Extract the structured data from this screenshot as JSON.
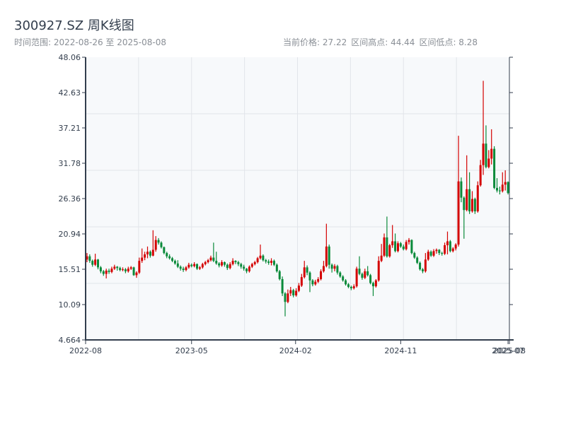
{
  "header": {
    "title": "300927.SZ 周K线图",
    "date_range": "时间范围: 2022-08-26 至 2025-08-08",
    "current_price": "当前价格: 27.22",
    "range_high": "区间高点: 44.44",
    "range_low": "区间低点: 8.28"
  },
  "chart_data": {
    "type": "candlestick",
    "title": "300927.SZ 周K线图",
    "ylim": [
      4.664,
      48.06
    ],
    "y_ticks": [
      "48.06",
      "42.63",
      "37.21",
      "31.78",
      "26.36",
      "20.94",
      "15.51",
      "10.09",
      "4.664"
    ],
    "x_ticks": [
      {
        "label": "2022-08",
        "index": 0
      },
      {
        "label": "2023-05",
        "index": 38.5
      },
      {
        "label": "2024-02",
        "index": 76.3
      },
      {
        "label": "2024-11",
        "index": 114.5
      },
      {
        "label": "2025-07",
        "index": 153.5
      },
      {
        "label": "2025-08",
        "index": 154.6
      }
    ],
    "grid": true,
    "colors": {
      "up": "#d40000",
      "down": "#0a8a3a",
      "axis": "#333e4d",
      "grid": "#e2e5ea",
      "plot_bg": "#f7f9fb"
    },
    "ohlc": [
      [
        17.0,
        18.0,
        16.6,
        17.5
      ],
      [
        17.5,
        17.8,
        16.5,
        16.8
      ],
      [
        16.8,
        17.0,
        15.9,
        16.2
      ],
      [
        16.2,
        17.9,
        16.0,
        17.0
      ],
      [
        17.0,
        17.1,
        15.5,
        15.8
      ],
      [
        15.8,
        16.0,
        14.9,
        15.2
      ],
      [
        15.2,
        15.4,
        14.5,
        14.8
      ],
      [
        14.8,
        15.6,
        14.1,
        15.3
      ],
      [
        15.3,
        15.6,
        14.8,
        15.1
      ],
      [
        15.1,
        15.9,
        14.9,
        15.6
      ],
      [
        15.6,
        16.2,
        15.4,
        15.9
      ],
      [
        15.9,
        16.0,
        15.3,
        15.7
      ],
      [
        15.7,
        15.9,
        15.2,
        15.4
      ],
      [
        15.4,
        15.8,
        15.2,
        15.5
      ],
      [
        15.5,
        15.7,
        14.9,
        15.2
      ],
      [
        15.2,
        15.9,
        15.0,
        15.6
      ],
      [
        15.6,
        16.0,
        15.4,
        15.8
      ],
      [
        15.8,
        15.9,
        14.5,
        14.6
      ],
      [
        14.6,
        15.2,
        14.2,
        15.0
      ],
      [
        15.0,
        17.3,
        14.8,
        16.8
      ],
      [
        16.8,
        18.7,
        16.5,
        17.3
      ],
      [
        17.3,
        18.2,
        16.9,
        17.8
      ],
      [
        17.8,
        19.0,
        17.2,
        18.2
      ],
      [
        18.2,
        18.4,
        17.3,
        17.6
      ],
      [
        17.6,
        21.5,
        17.5,
        18.5
      ],
      [
        18.5,
        20.6,
        18.2,
        20.0
      ],
      [
        20.0,
        20.3,
        19.3,
        19.6
      ],
      [
        19.6,
        19.8,
        18.7,
        18.9
      ],
      [
        18.9,
        19.0,
        17.8,
        18.0
      ],
      [
        18.0,
        18.2,
        17.2,
        17.5
      ],
      [
        17.5,
        17.8,
        17.0,
        17.2
      ],
      [
        17.2,
        17.4,
        16.6,
        16.8
      ],
      [
        16.8,
        17.0,
        16.2,
        16.4
      ],
      [
        16.4,
        16.9,
        15.7,
        15.9
      ],
      [
        15.9,
        16.1,
        15.3,
        15.6
      ],
      [
        15.6,
        15.9,
        15.1,
        15.4
      ],
      [
        15.4,
        16.0,
        15.2,
        15.8
      ],
      [
        15.8,
        16.5,
        15.6,
        16.2
      ],
      [
        16.2,
        16.4,
        15.8,
        16.0
      ],
      [
        16.0,
        16.6,
        15.8,
        16.3
      ],
      [
        16.3,
        16.4,
        15.4,
        15.6
      ],
      [
        15.6,
        16.0,
        15.4,
        15.8
      ],
      [
        15.8,
        16.5,
        15.6,
        16.3
      ],
      [
        16.3,
        16.8,
        16.1,
        16.6
      ],
      [
        16.6,
        17.1,
        16.4,
        16.9
      ],
      [
        16.9,
        17.6,
        16.7,
        17.3
      ],
      [
        17.3,
        19.6,
        16.6,
        16.8
      ],
      [
        16.8,
        18.2,
        16.2,
        16.4
      ],
      [
        16.4,
        16.6,
        15.8,
        16.1
      ],
      [
        16.1,
        16.9,
        15.9,
        16.6
      ],
      [
        16.6,
        16.7,
        15.9,
        16.2
      ],
      [
        16.2,
        16.4,
        15.4,
        15.7
      ],
      [
        15.7,
        16.6,
        15.5,
        16.3
      ],
      [
        16.3,
        17.2,
        16.1,
        16.8
      ],
      [
        16.8,
        16.9,
        16.3,
        16.6
      ],
      [
        16.6,
        16.8,
        16.0,
        16.3
      ],
      [
        16.3,
        16.5,
        15.6,
        15.9
      ],
      [
        15.9,
        16.2,
        15.3,
        15.6
      ],
      [
        15.6,
        15.7,
        14.9,
        15.2
      ],
      [
        15.2,
        16.1,
        15.0,
        15.9
      ],
      [
        15.9,
        16.5,
        15.7,
        16.3
      ],
      [
        16.3,
        16.8,
        16.1,
        16.6
      ],
      [
        16.6,
        17.4,
        16.4,
        17.2
      ],
      [
        17.2,
        19.3,
        17.0,
        17.6
      ],
      [
        17.6,
        17.8,
        16.7,
        16.9
      ],
      [
        16.9,
        17.1,
        16.4,
        16.7
      ],
      [
        16.7,
        17.0,
        16.2,
        16.5
      ],
      [
        16.5,
        17.2,
        16.1,
        16.8
      ],
      [
        16.8,
        17.0,
        16.0,
        16.2
      ],
      [
        16.2,
        16.4,
        15.0,
        15.2
      ],
      [
        15.2,
        15.4,
        13.8,
        14.0
      ],
      [
        14.0,
        14.4,
        11.4,
        11.8
      ],
      [
        11.8,
        12.0,
        8.28,
        10.5
      ],
      [
        10.5,
        12.4,
        10.3,
        11.8
      ],
      [
        11.8,
        12.8,
        11.4,
        12.3
      ],
      [
        12.3,
        12.5,
        11.2,
        11.5
      ],
      [
        11.5,
        12.6,
        11.3,
        12.2
      ],
      [
        12.2,
        13.4,
        12.0,
        13.0
      ],
      [
        13.0,
        14.8,
        12.8,
        14.3
      ],
      [
        14.3,
        16.8,
        14.1,
        15.8
      ],
      [
        15.8,
        16.1,
        14.6,
        15.0
      ],
      [
        15.0,
        15.2,
        12.0,
        13.8
      ],
      [
        13.8,
        14.0,
        12.9,
        13.2
      ],
      [
        13.2,
        13.9,
        13.0,
        13.6
      ],
      [
        13.6,
        14.3,
        13.4,
        14.0
      ],
      [
        14.0,
        15.5,
        13.8,
        15.2
      ],
      [
        15.2,
        16.8,
        15.0,
        16.0
      ],
      [
        16.0,
        22.5,
        15.8,
        19.0
      ],
      [
        19.0,
        19.3,
        15.6,
        16.2
      ],
      [
        16.2,
        16.4,
        15.0,
        15.6
      ],
      [
        15.6,
        16.3,
        15.2,
        16.0
      ],
      [
        16.0,
        16.2,
        14.7,
        15.0
      ],
      [
        15.0,
        15.2,
        14.2,
        14.4
      ],
      [
        14.4,
        14.6,
        13.6,
        13.8
      ],
      [
        13.8,
        14.0,
        13.0,
        13.2
      ],
      [
        13.2,
        13.4,
        12.6,
        12.8
      ],
      [
        12.8,
        13.0,
        12.3,
        12.6
      ],
      [
        12.6,
        13.2,
        12.4,
        12.9
      ],
      [
        12.9,
        15.9,
        12.7,
        15.6
      ],
      [
        15.6,
        17.5,
        14.6,
        14.8
      ],
      [
        14.8,
        15.0,
        13.9,
        14.2
      ],
      [
        14.2,
        15.6,
        14.0,
        15.2
      ],
      [
        15.2,
        16.0,
        14.4,
        14.6
      ],
      [
        14.6,
        14.8,
        13.2,
        13.4
      ],
      [
        13.4,
        13.6,
        11.4,
        12.9
      ],
      [
        12.9,
        14.0,
        12.7,
        13.8
      ],
      [
        13.8,
        17.5,
        13.6,
        16.8
      ],
      [
        16.8,
        19.4,
        16.6,
        17.6
      ],
      [
        17.6,
        21.0,
        17.4,
        20.4
      ],
      [
        20.4,
        23.6,
        17.3,
        17.5
      ],
      [
        17.5,
        19.4,
        17.3,
        19.2
      ],
      [
        19.2,
        22.3,
        18.8,
        19.8
      ],
      [
        19.8,
        21.0,
        18.1,
        18.3
      ],
      [
        18.3,
        19.8,
        18.1,
        19.5
      ],
      [
        19.5,
        19.7,
        18.8,
        19.0
      ],
      [
        19.0,
        19.3,
        18.4,
        18.6
      ],
      [
        18.6,
        20.0,
        18.4,
        19.7
      ],
      [
        19.7,
        20.3,
        19.3,
        20.0
      ],
      [
        20.0,
        20.1,
        17.8,
        18.0
      ],
      [
        18.0,
        18.2,
        17.1,
        17.3
      ],
      [
        17.3,
        17.5,
        16.3,
        16.5
      ],
      [
        16.5,
        16.7,
        15.3,
        15.5
      ],
      [
        15.5,
        15.7,
        14.9,
        15.2
      ],
      [
        15.2,
        18.0,
        15.0,
        17.0
      ],
      [
        17.0,
        18.5,
        16.8,
        18.2
      ],
      [
        18.2,
        18.4,
        17.4,
        17.6
      ],
      [
        17.6,
        18.6,
        17.4,
        18.3
      ],
      [
        18.3,
        18.7,
        17.9,
        18.5
      ],
      [
        18.5,
        18.6,
        17.7,
        18.0
      ],
      [
        18.0,
        18.2,
        17.6,
        17.9
      ],
      [
        17.9,
        19.6,
        17.7,
        19.2
      ],
      [
        19.2,
        21.3,
        17.8,
        19.8
      ],
      [
        19.8,
        20.0,
        18.1,
        18.3
      ],
      [
        18.3,
        18.9,
        18.1,
        18.7
      ],
      [
        18.7,
        19.5,
        18.4,
        19.3
      ],
      [
        19.3,
        36.0,
        19.0,
        29.0
      ],
      [
        29.0,
        29.6,
        25.8,
        26.5
      ],
      [
        26.5,
        26.7,
        20.2,
        24.6
      ],
      [
        24.6,
        33.0,
        24.4,
        27.8
      ],
      [
        27.8,
        30.4,
        24.0,
        24.4
      ],
      [
        24.4,
        27.5,
        24.2,
        26.3
      ],
      [
        26.3,
        26.5,
        24.0,
        24.4
      ],
      [
        24.4,
        29.0,
        24.2,
        28.4
      ],
      [
        28.4,
        32.3,
        28.2,
        31.5
      ],
      [
        31.5,
        44.44,
        30.0,
        34.8
      ],
      [
        34.8,
        37.6,
        31.0,
        31.2
      ],
      [
        31.2,
        33.8,
        31.0,
        32.5
      ],
      [
        32.5,
        37.0,
        31.6,
        34.0
      ],
      [
        34.0,
        34.4,
        27.8,
        28.0
      ],
      [
        28.0,
        29.5,
        27.3,
        27.6
      ],
      [
        27.6,
        28.2,
        27.0,
        27.5
      ],
      [
        27.5,
        30.4,
        27.3,
        28.5
      ],
      [
        28.5,
        30.7,
        27.6,
        28.9
      ],
      [
        28.9,
        29.0,
        27.0,
        27.22
      ]
    ]
  }
}
